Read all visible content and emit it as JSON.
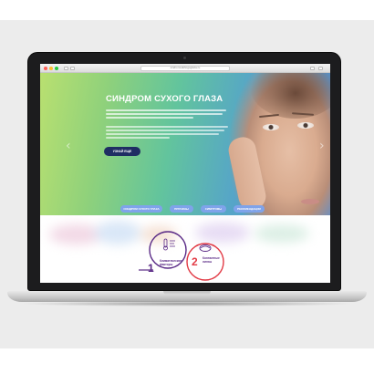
{
  "browser": {
    "url": "sindromsukhogoglaza.ru"
  },
  "hero": {
    "title": "СИНДРОМ СУХОГО ГЛАЗА",
    "cta_label": "УЗНАЙ ЕЩЕ",
    "prev_arrow": "‹",
    "next_arrow": "›"
  },
  "nav_pills": [
    {
      "label": "СИНДРОМ СУХОГО ГЛАЗА"
    },
    {
      "label": "ПРИЧИНЫ"
    },
    {
      "label": "СИМПТОМЫ"
    },
    {
      "label": "РЕКОМЕНДАЦИИ"
    }
  ],
  "causes": {
    "item1_number": "1",
    "item1_label_line1": "Климатические",
    "item1_label_line2": "факторы",
    "item2_number": "2",
    "item2_label_line1": "Контактные",
    "item2_label_line2": "линзы"
  },
  "colors": {
    "accent_navy": "#1f2d63",
    "pill_blue": "#7fa3ea",
    "diagram_purple": "#5a2a86",
    "diagram_red": "#e23a45",
    "hero_green": "#b9e070",
    "hero_blue": "#5a8fd0"
  }
}
